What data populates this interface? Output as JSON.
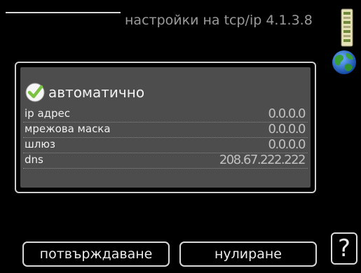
{
  "header": {
    "title": "настройки на tcp/ip 4.1.3.8"
  },
  "icons": {
    "thermo": "thermometer-icon",
    "globe": "globe-icon",
    "check": "checkmark-icon"
  },
  "automatic": {
    "label": "автоматично",
    "checked": true
  },
  "fields": [
    {
      "label": "ip адрес",
      "value": "0.0.0.0"
    },
    {
      "label": "мрежова маска",
      "value": "0.0.0.0"
    },
    {
      "label": "шлюз",
      "value": "0.0.0.0"
    },
    {
      "label": "dns",
      "value": "208.67.222.222"
    }
  ],
  "buttons": {
    "confirm": "потвърждаване",
    "reset": "нулиране",
    "help": "?"
  },
  "colors": {
    "panel_background": "#4d4d4d",
    "check_green": "#7cc242"
  }
}
